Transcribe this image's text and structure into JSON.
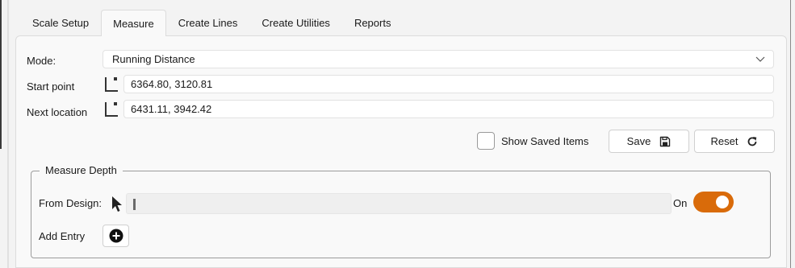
{
  "tabs": [
    {
      "label": "Scale Setup"
    },
    {
      "label": "Measure"
    },
    {
      "label": "Create Lines"
    },
    {
      "label": "Create Utilities"
    },
    {
      "label": "Reports"
    }
  ],
  "active_tab": "Measure",
  "mode": {
    "label": "Mode:",
    "value": "Running Distance"
  },
  "start_point": {
    "label": "Start point",
    "value": "6364.80, 3120.81"
  },
  "next_location": {
    "label": "Next location",
    "value": "6431.11, 3942.42"
  },
  "show_saved": {
    "label": "Show Saved Items",
    "checked": false
  },
  "save_button": {
    "label": "Save",
    "icon": "save-icon"
  },
  "reset_button": {
    "label": "Reset",
    "icon": "refresh-icon"
  },
  "measure_depth": {
    "legend": "Measure Depth",
    "from_design_label": "From Design:",
    "from_design_value": "",
    "toggle_label": "On",
    "toggle_on": true,
    "add_entry_label": "Add Entry"
  },
  "colors": {
    "accent": "#d96b0a"
  }
}
